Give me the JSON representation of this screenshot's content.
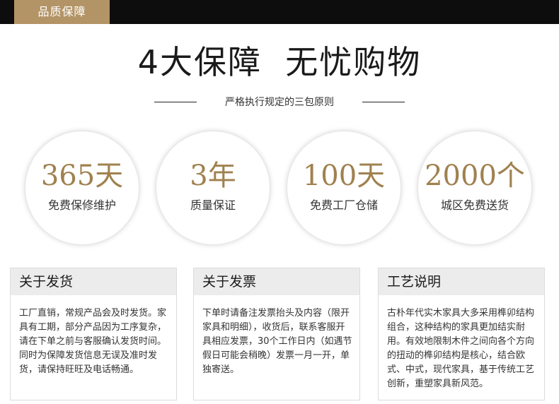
{
  "header": {
    "tag_label": "品质保障"
  },
  "headline": "4大保障  无忧购物",
  "subtitle": "严格执行规定的三包原则",
  "guarantees": [
    {
      "value": "365天",
      "label": "免费保修维护"
    },
    {
      "value": "3年",
      "label": "质量保证"
    },
    {
      "value": "100天",
      "label": "免费工厂仓储"
    },
    {
      "value": "2000个",
      "label": "城区免费送货"
    }
  ],
  "cards": [
    {
      "title": "关于发货",
      "paragraphs": [
        "工厂直销，常规产品会及时发货。家具有工期，部分产品因为工序复杂，请在下单之前与客服确认发货时间。",
        "同时为保障发货信息无误及准时发货，请保持旺旺及电话畅通。"
      ]
    },
    {
      "title": "关于发票",
      "paragraphs": [
        "下单时请备注发票抬头及内容（限开家具和明细），收货后，联系客服开具相应发票，30个工作日内（如遇节假日可能会稍晚）发票一月一开，单独寄送。"
      ]
    },
    {
      "title": "工艺说明",
      "paragraphs": [
        "古朴年代实木家具大多采用榫卯结构组合，这种结构的家具更加结实耐用。有效地限制木件之间向各个方向的扭动的榫卯结构是核心，结合欧式、中式，现代家具，基于传统工艺创新，重塑家具新风范。"
      ]
    }
  ],
  "colors": {
    "topbar": "#0d0d0d",
    "accent_gold": "#b39466",
    "value_gold": "#a0814f",
    "card_header_bg": "#ececec"
  }
}
